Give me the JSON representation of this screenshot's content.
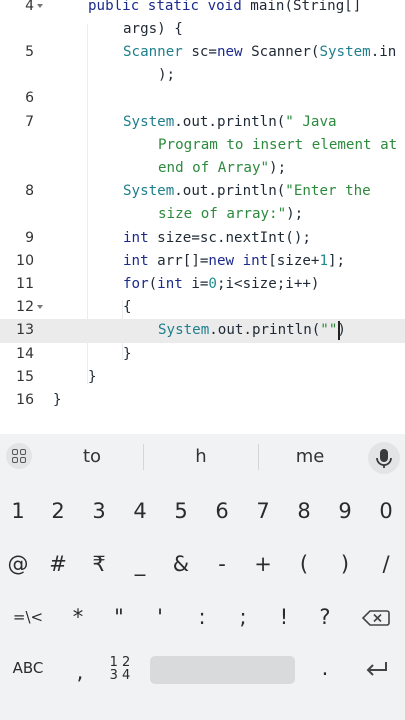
{
  "editor": {
    "lines": [
      {
        "num": "4",
        "fold": true
      },
      {
        "num": "5",
        "fold": false
      },
      {
        "num": "6",
        "fold": false
      },
      {
        "num": "7",
        "fold": false
      },
      {
        "num": "8",
        "fold": false
      },
      {
        "num": "9",
        "fold": false
      },
      {
        "num": "10",
        "fold": false
      },
      {
        "num": "11",
        "fold": false
      },
      {
        "num": "12",
        "fold": true
      },
      {
        "num": "13",
        "fold": false
      },
      {
        "num": "14",
        "fold": false
      },
      {
        "num": "15",
        "fold": false
      },
      {
        "num": "16",
        "fold": false
      }
    ],
    "code": {
      "l4a_kw": "public static void ",
      "l4a_rest": "main(String[]",
      "l4b": "args) {",
      "l5a_cls": "Scanner",
      "l5a_mid": " sc=",
      "l5a_kw": "new",
      "l5a_rest": " Scanner(",
      "l5a_sys": "System",
      "l5a_end": ".in",
      "l5b": ");",
      "l7a_sys": "System",
      "l7a_mid": ".out.println(",
      "l7a_str": "\" Java",
      "l7b": "Program to insert element at",
      "l7c_str": "end of Array\"",
      "l7c_end": ");",
      "l8a_sys": "System",
      "l8a_mid": ".out.println(",
      "l8a_str": "\"Enter the",
      "l8b_str": "size of array:\"",
      "l8b_end": ");",
      "l9_kw": "int",
      "l9_rest": " size=sc.nextInt();",
      "l10_kw1": "int",
      "l10_mid": " arr[]=",
      "l10_kw2": "new",
      "l10_sp": " ",
      "l10_kw3": "int",
      "l10_a": "[size+",
      "l10_num": "1",
      "l10_b": "];",
      "l11_kw1": "for",
      "l11_a": "(",
      "l11_kw2": "int",
      "l11_b": " i=",
      "l11_num": "0",
      "l11_c": ";i<size;i++)",
      "l12": "{",
      "l13_sys": "System",
      "l13_mid": ".out.println(",
      "l13_str": "\"\"",
      "l13_end": ")",
      "l14": "}",
      "l15": "}",
      "l16": "}"
    }
  },
  "keyboard": {
    "suggestions": [
      "to",
      "h",
      "me"
    ],
    "row_numbers": [
      "1",
      "2",
      "3",
      "4",
      "5",
      "6",
      "7",
      "8",
      "9",
      "0"
    ],
    "row_symbols1": [
      "@",
      "#",
      "₹",
      "_",
      "&",
      "-",
      "+",
      "(",
      ")",
      "/"
    ],
    "row_symbols2": [
      "=\\<",
      "*",
      "\"",
      "'",
      ":",
      ";",
      "!",
      "?"
    ],
    "abc_label": "ABC",
    "comma": ",",
    "numsym_top": "1 2",
    "numsym_bottom": "3 4",
    "period": ".",
    "enter_icon": "enter-icon",
    "backspace_icon": "backspace-icon",
    "mic_icon": "mic-icon",
    "grid_icon": "grid-icon"
  }
}
